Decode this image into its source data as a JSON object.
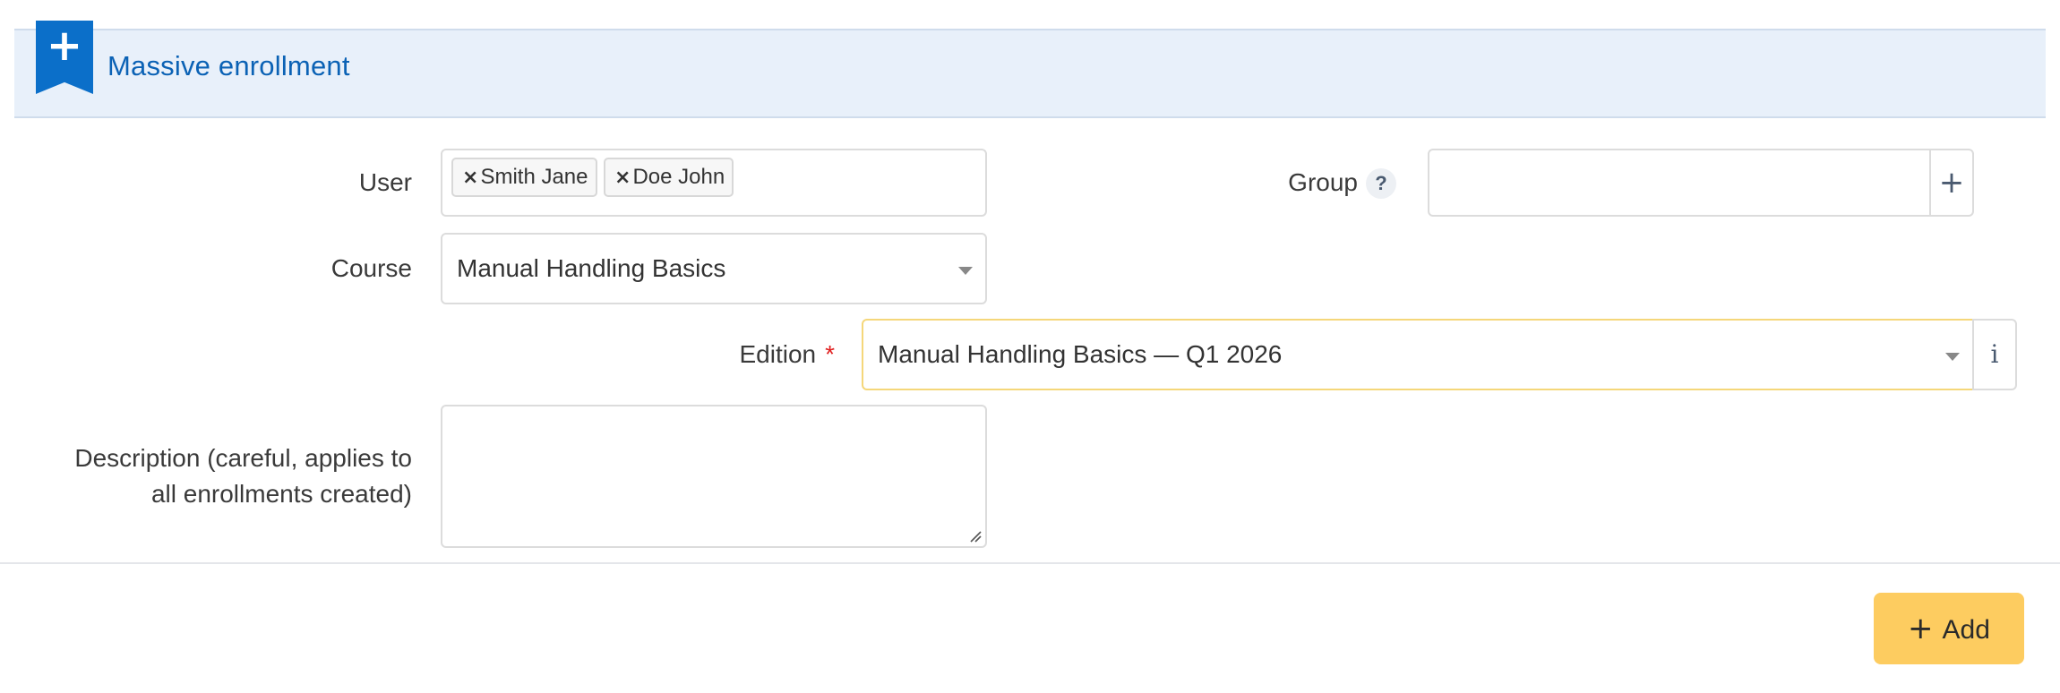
{
  "panel": {
    "title": "Massive enrollment",
    "icon": "plus-bookmark-icon",
    "accent_color": "#0b6fc9"
  },
  "form": {
    "user": {
      "label": "User",
      "tags": [
        "Smith Jane",
        "Doe John"
      ],
      "remove_glyph": "×"
    },
    "group": {
      "label": "Group",
      "help_glyph": "?",
      "value": "",
      "add_glyph": "+"
    },
    "course": {
      "label": "Course",
      "selected": "Manual Handling Basics"
    },
    "edition": {
      "label": "Edition",
      "required_mark": "*",
      "selected": "Manual Handling Basics — Q1 2026",
      "info_glyph": "i",
      "highlight_color": "#f5d77a"
    },
    "description": {
      "label_line1": "Description (careful, applies to",
      "label_line2": "all enrollments created)",
      "value": ""
    }
  },
  "actions": {
    "add_label": "Add",
    "add_glyph": "+",
    "add_color": "#fdcc60"
  }
}
